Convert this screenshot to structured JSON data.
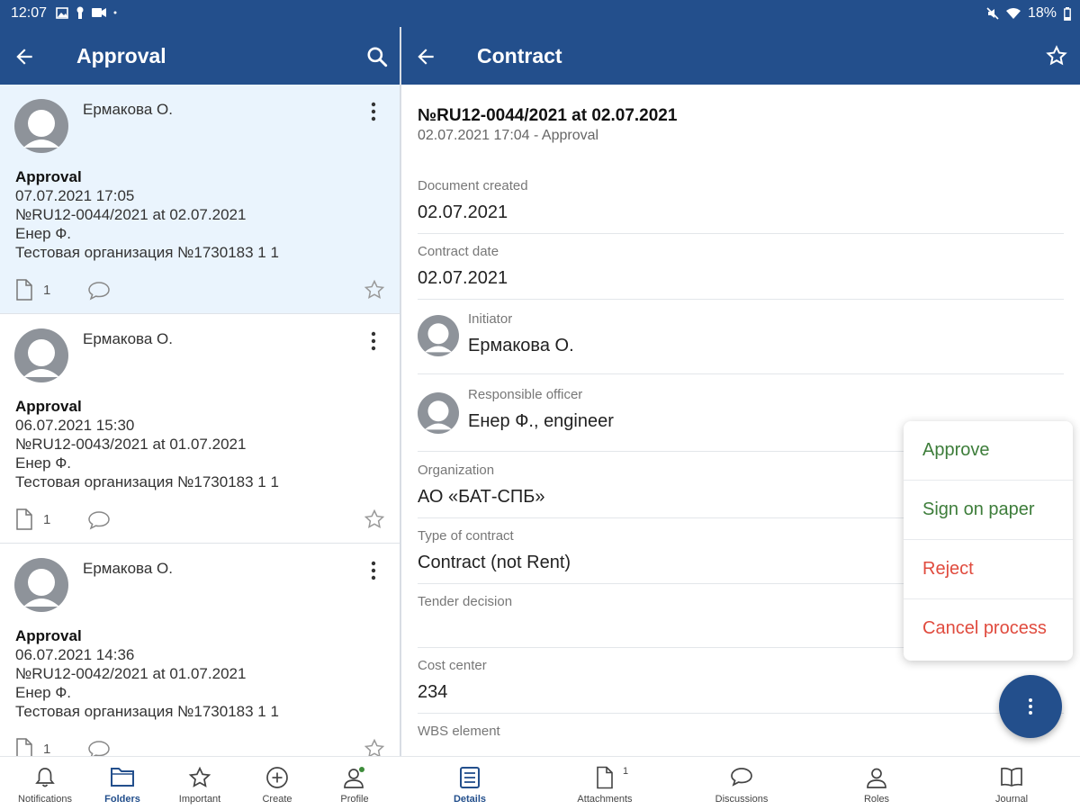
{
  "status_bar": {
    "time": "12:07",
    "battery": "18%"
  },
  "left_panel": {
    "title": "Approval",
    "items": [
      {
        "author": "Ермакова О.",
        "title": "Approval",
        "datetime": "07.07.2021 17:05",
        "doc_ref": "№RU12-0044/2021 at 02.07.2021",
        "person": "Енер Ф.",
        "org": "Тестовая организация №1730183 1 1",
        "attachments": "1",
        "selected": true
      },
      {
        "author": "Ермакова О.",
        "title": "Approval",
        "datetime": "06.07.2021 15:30",
        "doc_ref": "№RU12-0043/2021 at 01.07.2021",
        "person": "Енер Ф.",
        "org": "Тестовая организация №1730183 1 1",
        "attachments": "1",
        "selected": false
      },
      {
        "author": "Ермакова О.",
        "title": "Approval",
        "datetime": "06.07.2021 14:36",
        "doc_ref": "№RU12-0042/2021 at 01.07.2021",
        "person": "Енер Ф.",
        "org": "Тестовая организация №1730183 1 1",
        "attachments": "1",
        "selected": false
      }
    ]
  },
  "right_panel": {
    "title": "Contract",
    "doc_number": "№RU12-0044/2021 at 02.07.2021",
    "doc_subtitle": "02.07.2021 17:04 - Approval",
    "fields": {
      "document_created": {
        "label": "Document created",
        "value": "02.07.2021"
      },
      "contract_date": {
        "label": "Contract date",
        "value": "02.07.2021"
      },
      "initiator": {
        "label": "Initiator",
        "value": "Ермакова О."
      },
      "responsible_officer": {
        "label": "Responsible officer",
        "value": "Енер Ф., engineer"
      },
      "organization": {
        "label": "Organization",
        "value": "АО «БАТ-СПБ»"
      },
      "type_of_contract": {
        "label": "Type of contract",
        "value": "Contract (not Rent)"
      },
      "tender_decision": {
        "label": "Tender decision",
        "value": ""
      },
      "cost_center": {
        "label": "Cost center",
        "value": "234"
      },
      "wbs_element": {
        "label": "WBS element",
        "value": ""
      }
    }
  },
  "action_menu": {
    "approve": "Approve",
    "sign_on_paper": "Sign on paper",
    "reject": "Reject",
    "cancel_process": "Cancel process"
  },
  "bottom_nav_left": {
    "notifications": "Notifications",
    "folders": "Folders",
    "important": "Important",
    "create": "Create",
    "profile": "Profile"
  },
  "bottom_nav_right": {
    "details": "Details",
    "attachments": "Attachments",
    "attachments_badge": "1",
    "discussions": "Discussions",
    "roles": "Roles",
    "journal": "Journal"
  },
  "colors": {
    "primary": "#234f8c",
    "selected_row": "#eaf4fd",
    "approve": "#3d7d3a",
    "reject": "#e04b3e"
  }
}
